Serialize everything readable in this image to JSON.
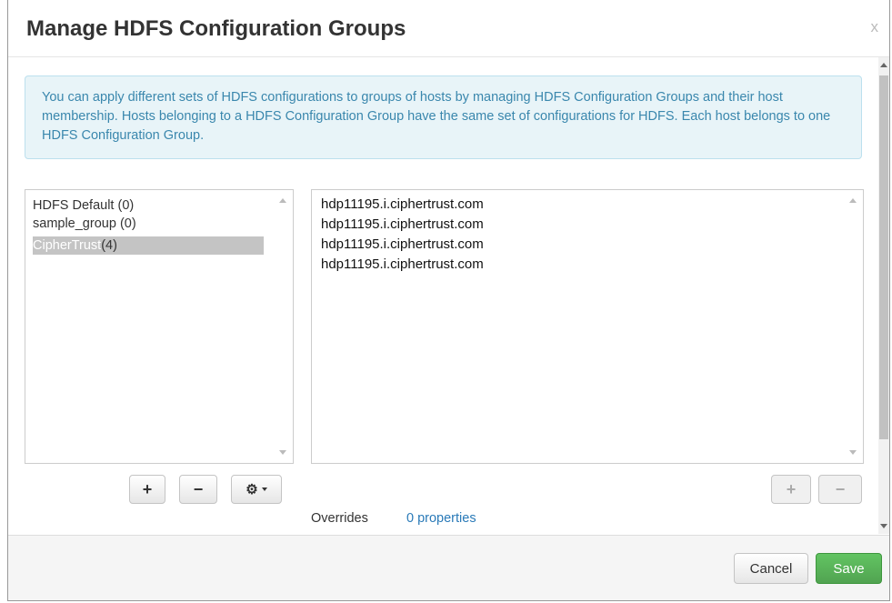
{
  "dialog": {
    "title": "Manage HDFS Configuration Groups",
    "close_label": "x"
  },
  "info": {
    "text": "You can apply different sets of HDFS configurations to groups of hosts by managing HDFS Configuration Groups and their host membership. Hosts belonging to a HDFS Configuration Group have the same set of configurations for HDFS. Each host belongs to one HDFS Configuration Group."
  },
  "groups": [
    {
      "name": "HDFS Default",
      "count": "(0)"
    },
    {
      "name": "sample_group",
      "count": "(0)"
    },
    {
      "name": "CipherTrust",
      "count": "(4)",
      "selected": true
    }
  ],
  "hosts": [
    "hdp11195.i.ciphertrust.com",
    "hdp11195.i.ciphertrust.com",
    "hdp11195.i.ciphertrust.com",
    "hdp11195.i.ciphertrust.com"
  ],
  "group_buttons": {
    "add": "+",
    "remove": "−",
    "settings": "⚙"
  },
  "host_buttons": {
    "add": "+",
    "remove": "−"
  },
  "overrides": {
    "label": "Overrides",
    "link": "0 properties"
  },
  "footer": {
    "cancel": "Cancel",
    "save": "Save"
  },
  "colors": {
    "info_bg": "#e8f4f8",
    "info_text": "#3a87ad",
    "save_bg": "#51a351",
    "link": "#2a7ab8",
    "selected_bg": "#c4c4c4"
  }
}
